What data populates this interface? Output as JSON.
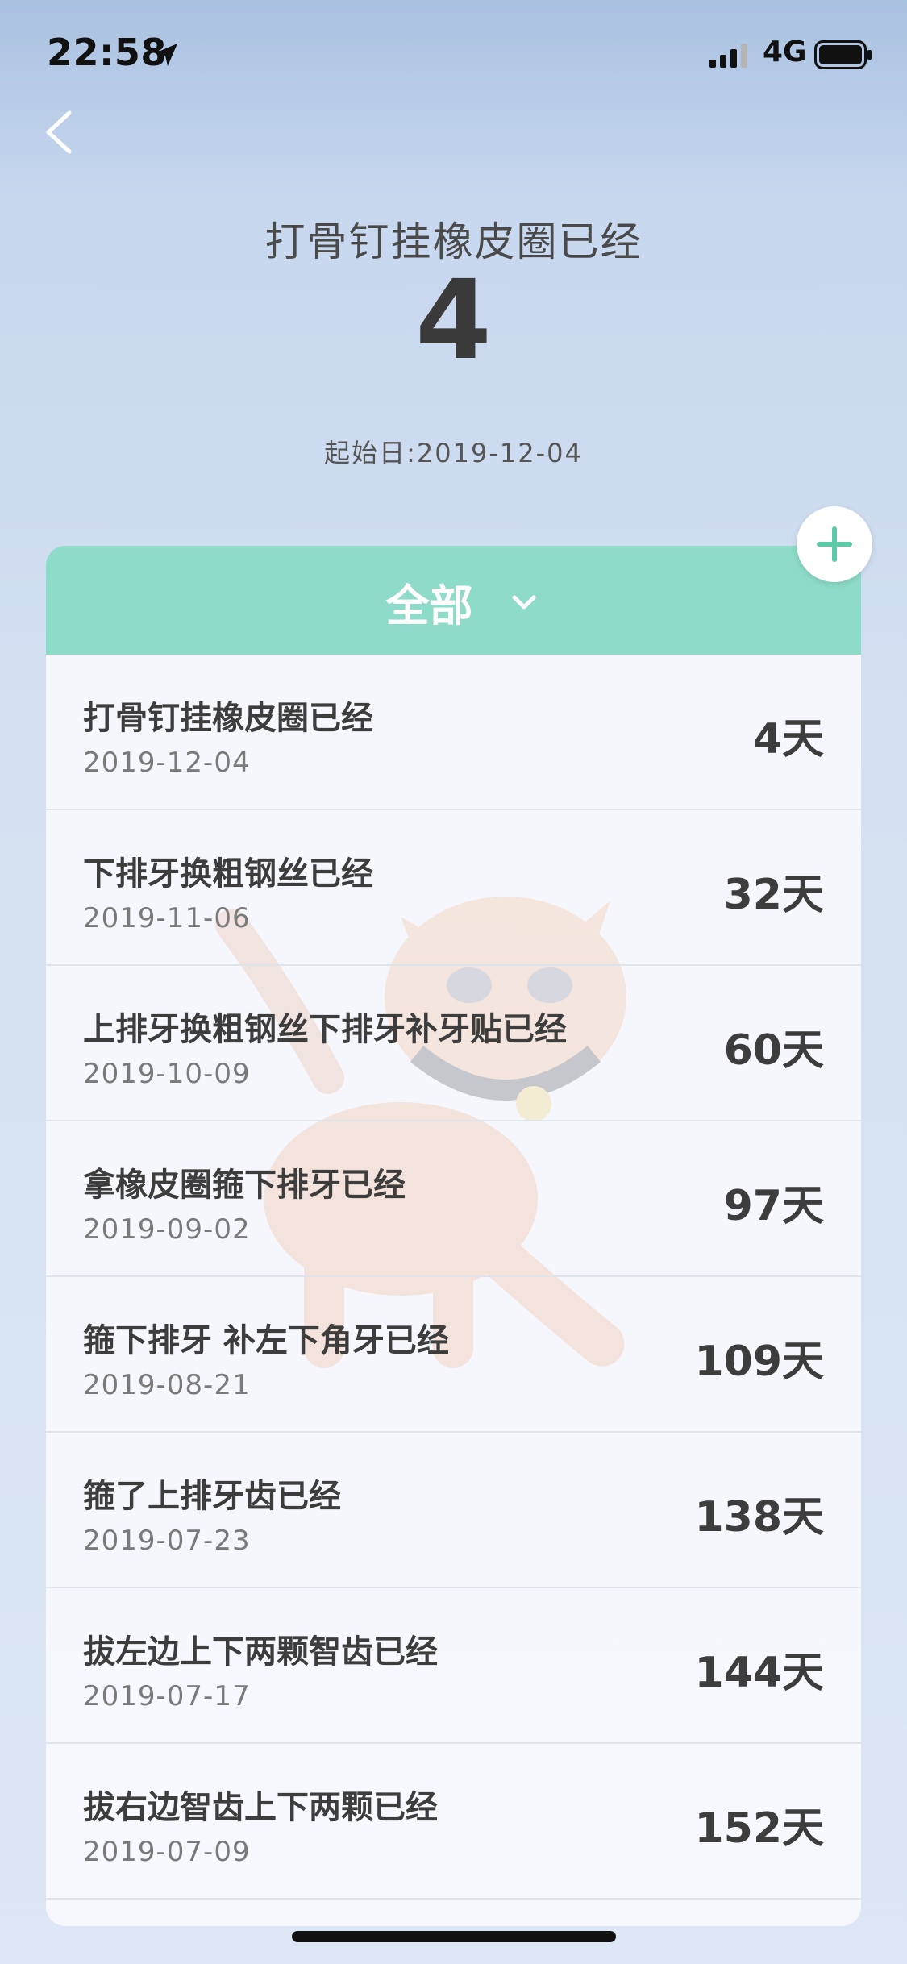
{
  "status_bar": {
    "time": "22:58",
    "network": "4G",
    "location_icon": "location-arrow-icon",
    "signal_icon": "cellular-signal-icon",
    "battery_icon": "battery-icon"
  },
  "nav": {
    "back_icon": "chevron-left-icon"
  },
  "header": {
    "title": "打骨钉挂橡皮圈已经",
    "count": "4",
    "start_date": "起始日:2019-12-04"
  },
  "filter": {
    "label": "全部",
    "icon": "chevron-down-icon"
  },
  "add_button": {
    "icon": "plus-icon",
    "color": "#5cc9a7"
  },
  "colors": {
    "accent": "#8ddbc8"
  },
  "items": [
    {
      "title": "打骨钉挂橡皮圈已经",
      "date": "2019-12-04",
      "days": "4天"
    },
    {
      "title": "下排牙换粗钢丝已经",
      "date": "2019-11-06",
      "days": "32天"
    },
    {
      "title": "上排牙换粗钢丝下排牙补牙贴已经",
      "date": "2019-10-09",
      "days": "60天"
    },
    {
      "title": "拿橡皮圈箍下排牙已经",
      "date": "2019-09-02",
      "days": "97天"
    },
    {
      "title": "箍下排牙 补左下角牙已经",
      "date": "2019-08-21",
      "days": "109天"
    },
    {
      "title": "箍了上排牙齿已经",
      "date": "2019-07-23",
      "days": "138天"
    },
    {
      "title": "拔左边上下两颗智齿已经",
      "date": "2019-07-17",
      "days": "144天"
    },
    {
      "title": "拔右边智齿上下两颗已经",
      "date": "2019-07-09",
      "days": "152天"
    }
  ]
}
